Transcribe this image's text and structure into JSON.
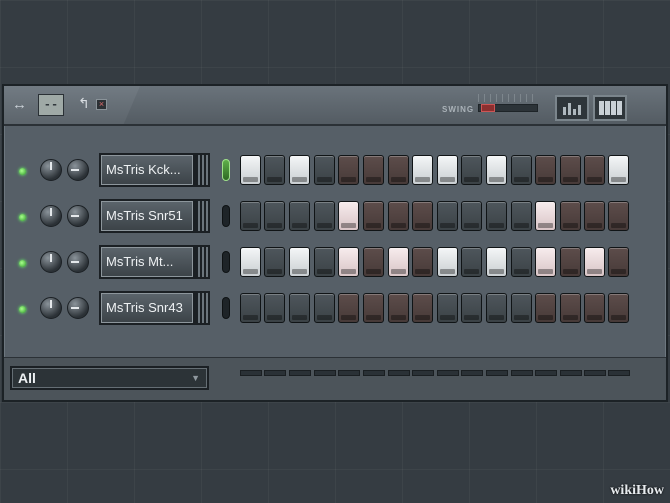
{
  "toolbar": {
    "pattern_display": "--",
    "swing_label": "SWING",
    "swing_value": 0.05,
    "icons": [
      "arrows-horizontal-icon",
      "undo-icon",
      "close-icon",
      "bars-view-icon",
      "piano-roll-icon"
    ]
  },
  "channels": [
    {
      "name": "MsTris Kck...",
      "selected": true,
      "steps": [
        "light",
        "dark",
        "light",
        "dark",
        "brown",
        "brown",
        "brown",
        "light",
        "light",
        "dark",
        "light",
        "dark",
        "brown",
        "brown",
        "brown",
        "light"
      ]
    },
    {
      "name": "MsTris Snr51",
      "selected": false,
      "steps": [
        "dark",
        "dark",
        "dark",
        "dark",
        "pink",
        "brown",
        "brown",
        "brown",
        "dark",
        "dark",
        "dark",
        "dark",
        "pink",
        "brown",
        "brown",
        "brown"
      ]
    },
    {
      "name": "MsTris Mt...",
      "selected": false,
      "steps": [
        "light",
        "dark",
        "light",
        "dark",
        "pink",
        "brown",
        "pink",
        "brown",
        "light",
        "dark",
        "light",
        "dark",
        "pink",
        "brown",
        "pink",
        "brown"
      ]
    },
    {
      "name": "MsTris Snr43",
      "selected": false,
      "steps": [
        "dark",
        "dark",
        "dark",
        "dark",
        "brown",
        "brown",
        "brown",
        "brown",
        "dark",
        "dark",
        "dark",
        "dark",
        "brown",
        "brown",
        "brown",
        "brown"
      ]
    }
  ],
  "filter": {
    "value": "All"
  },
  "watermark": "wikiHow",
  "colors": {
    "led_on": "#2e9a2a",
    "step_light": "#f4f6f7",
    "step_pink": "#f7eced",
    "step_brown": "#5d4d4b",
    "step_dark": "#4e565c"
  }
}
